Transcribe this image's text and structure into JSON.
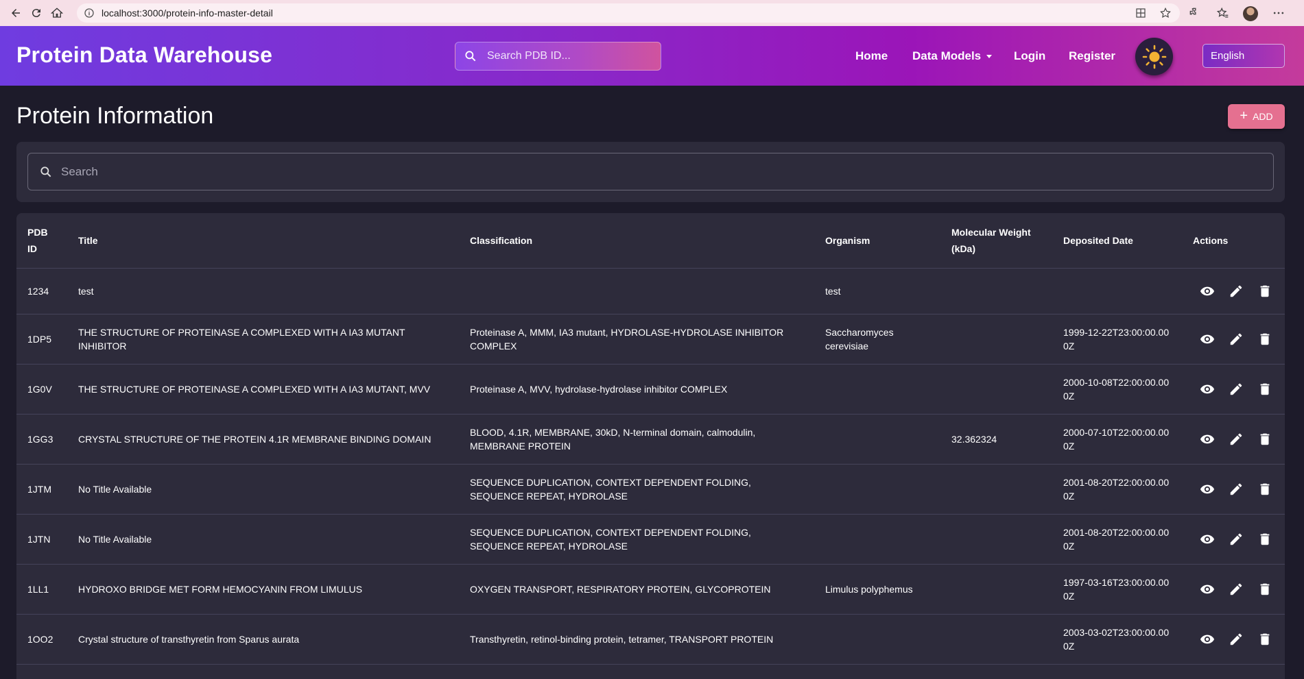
{
  "browser": {
    "url": "localhost:3000/protein-info-master-detail"
  },
  "header": {
    "brand": "Protein Data Warehouse",
    "search_placeholder": "Search PDB ID...",
    "nav": {
      "home": "Home",
      "data_models": "Data Models",
      "login": "Login",
      "register": "Register"
    },
    "language": "English"
  },
  "page": {
    "title": "Protein Information",
    "add_label": "ADD",
    "search_placeholder": "Search"
  },
  "table": {
    "columns": {
      "pdb_id": "PDB ID",
      "title": "Title",
      "classification": "Classification",
      "organism": "Organism",
      "molecular_weight": "Molecular Weight (kDa)",
      "deposited_date": "Deposited Date",
      "actions": "Actions"
    },
    "rows": [
      {
        "pdb_id": "1234",
        "title": "test",
        "classification": "",
        "organism": "test",
        "molecular_weight": "",
        "deposited_date": ""
      },
      {
        "pdb_id": "1DP5",
        "title": "THE STRUCTURE OF PROTEINASE A COMPLEXED WITH A IA3 MUTANT INHIBITOR",
        "classification": "Proteinase A, MMM, IA3 mutant, HYDROLASE-HYDROLASE INHIBITOR COMPLEX",
        "organism": "Saccharomyces cerevisiae",
        "molecular_weight": "",
        "deposited_date": "1999-12-22T23:00:00.000Z"
      },
      {
        "pdb_id": "1G0V",
        "title": "THE STRUCTURE OF PROTEINASE A COMPLEXED WITH A IA3 MUTANT, MVV",
        "classification": "Proteinase A, MVV, hydrolase-hydrolase inhibitor COMPLEX",
        "organism": "",
        "molecular_weight": "",
        "deposited_date": "2000-10-08T22:00:00.000Z"
      },
      {
        "pdb_id": "1GG3",
        "title": "CRYSTAL STRUCTURE OF THE PROTEIN 4.1R MEMBRANE BINDING DOMAIN",
        "classification": "BLOOD, 4.1R, MEMBRANE, 30kD, N-terminal domain, calmodulin, MEMBRANE PROTEIN",
        "organism": "",
        "molecular_weight": "32.362324",
        "deposited_date": "2000-07-10T22:00:00.000Z"
      },
      {
        "pdb_id": "1JTM",
        "title": "No Title Available",
        "classification": "SEQUENCE DUPLICATION, CONTEXT DEPENDENT FOLDING, SEQUENCE REPEAT, HYDROLASE",
        "organism": "",
        "molecular_weight": "",
        "deposited_date": "2001-08-20T22:00:00.000Z"
      },
      {
        "pdb_id": "1JTN",
        "title": "No Title Available",
        "classification": "SEQUENCE DUPLICATION, CONTEXT DEPENDENT FOLDING, SEQUENCE REPEAT, HYDROLASE",
        "organism": "",
        "molecular_weight": "",
        "deposited_date": "2001-08-20T22:00:00.000Z"
      },
      {
        "pdb_id": "1LL1",
        "title": "HYDROXO BRIDGE MET FORM HEMOCYANIN FROM LIMULUS",
        "classification": "OXYGEN TRANSPORT, RESPIRATORY PROTEIN, GLYCOPROTEIN",
        "organism": "Limulus polyphemus",
        "molecular_weight": "",
        "deposited_date": "1997-03-16T23:00:00.000Z"
      },
      {
        "pdb_id": "1OO2",
        "title": "Crystal structure of transthyretin from Sparus aurata",
        "classification": "Transthyretin, retinol-binding protein, tetramer, TRANSPORT PROTEIN",
        "organism": "",
        "molecular_weight": "",
        "deposited_date": "2003-03-02T23:00:00.000Z"
      }
    ]
  },
  "colors": {
    "header_gradient_start": "#6f3ce0",
    "header_gradient_end": "#c43b9c",
    "page_bg": "#1d1b2a",
    "panel_bg": "#2d2b3b",
    "add_button": "#e57090",
    "sun": "#f2b233"
  },
  "icons": {
    "view": "eye-icon",
    "edit": "pencil-icon",
    "delete": "trash-icon",
    "theme": "sun-icon"
  }
}
